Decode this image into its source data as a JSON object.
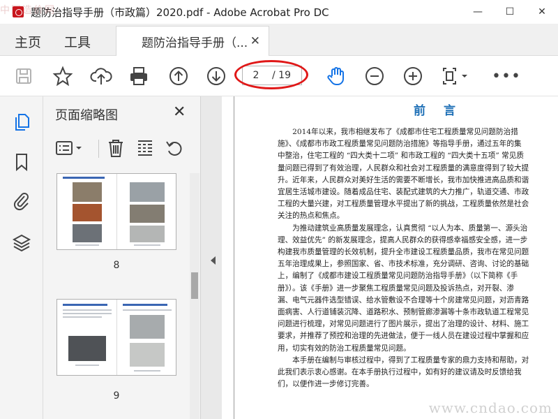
{
  "window": {
    "title": "题防治指导手册（市政篇）2020.pdf - Adobe Acrobat Pro DC",
    "watermark": "中国造价网",
    "minimize": "—",
    "maximize": "☐",
    "close": "✕"
  },
  "menu": {
    "home": "主页",
    "tools": "工具"
  },
  "tab": {
    "label": "题防治指导手册（...",
    "close": "✕"
  },
  "toolbar": {
    "page_current": "2",
    "page_total": "/ 19",
    "more": "•••"
  },
  "panel": {
    "title": "页面缩略图",
    "close": "✕",
    "thumbnails": [
      {
        "page_label": "8"
      },
      {
        "page_label": "9"
      }
    ]
  },
  "document": {
    "heading": "前言",
    "paragraphs": [
      "　　2014年以来，我市相继发布了《成都市住宅工程质量常见问题防治措",
      "施》、《成都市市政工程质量常见问题防治措施》等指导手册，通过五年的集",
      "中整治，住宅工程的 “四大类十二项” 和市政工程的 “四大类十五项” 常见质",
      "量问题已得到了有效治理，人民群众和社会对工程质量的满意度得到了较大提",
      "升。近年来，人民群众对美好生活的需要不断增长，我市加快推进高品质和谐",
      "宜居生活城市建设。随着成品住宅、装配式建筑的大力推广，轨道交通、市政",
      "工程的大量兴建，对工程质量管理水平提出了新的挑战，工程质量依然是社会",
      "关注的热点和焦点。",
      "　　为推动建筑业高质量发展理念，认真贯彻 “以人为本、质量第一、源头治",
      "理、效益优先” 的新发展理念，提高人民群众的获得感幸福感安全感，进一步",
      "构建我市质量管理的长效机制，提升全市建设工程质量品质，我市在常见问题",
      "五年治理成果上，参照国家、省、市技术标准，充分调研、咨询、讨论的基础",
      "上，编制了《成都市建设工程质量常见问题防治指导手册》（以下简称《手",
      "册》）。该《手册》进一步聚焦工程质量常见问题及投诉热点，对开裂、渗",
      "漏、电气元器件选型错误、给水管敷设不合理等十个房建常见问题，对沥青路",
      "面病害、人行道铺装沉降、道路积水、预制管廊渗漏等十条市政轨道工程常见",
      "问题进行梳理，对常见问题进行了图片展示，提出了治理的设计、材料、施工",
      "要求，并推荐了预控和治理的先进做法，便于一线人员在建设过程中掌握和应",
      "用，切实有效的防治工程质量常见问题。",
      "　　本手册在编制与审核过程中，得到了工程质量专家的鼎力支持和帮助，对",
      "此我们表示衷心感谢。在本手册执行过程中，如有好的建议请及时反馈给我",
      "们，以便作进一步修订完善。"
    ],
    "watermark": "www.cndao.com"
  },
  "colors": {
    "accent": "#1d6fb6",
    "highlight_ellipse": "#e01818"
  }
}
